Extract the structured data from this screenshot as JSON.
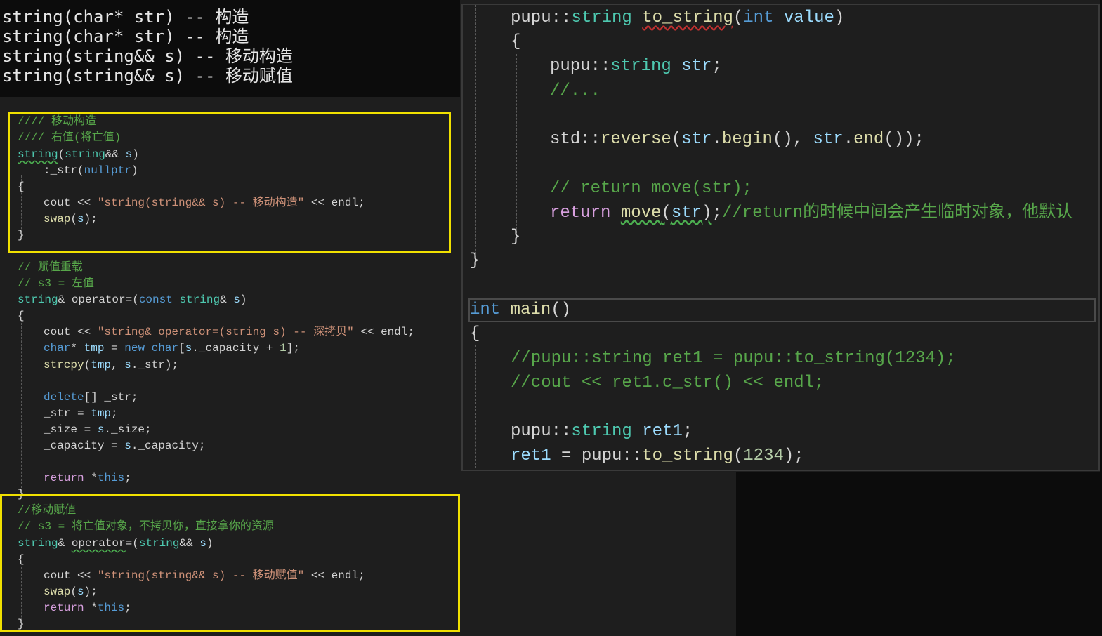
{
  "console": {
    "lines": [
      "string(char* str) -- 构造",
      "string(char* str) -- 构造",
      "string(string&& s) -- 移动构造",
      "string(string&& s) -- 移动赋值"
    ]
  },
  "left_code": {
    "c1": "//// 移动构造",
    "c2": "//// 右值(将亡值)",
    "c3": "// 赋值重载",
    "c4": "// s3 = 左值",
    "c5": "//移动赋值",
    "c6": "// s3 = 将亡值对象，不拷贝你，直接拿你的资源",
    "str_move_ctor": "\"string(string&& s) -- 移动构造\"",
    "str_copy_assign": "\"string& operator=(string s) -- 深拷贝\"",
    "str_move_assign": "\"string(string&& s) -- 移动赋值\""
  },
  "right_code": {
    "func_name": "to_string",
    "comment_etc": "//...",
    "comment_return": "// return move(str);",
    "comment_note": "//return的时候中间会产生临时对象，他默认",
    "main_name": "main",
    "comment_main1": "//pupu::string ret1 = pupu::to_string(1234);",
    "comment_main2": "//cout << ret1.c_str() << endl;",
    "number": "1234"
  },
  "colors": {
    "highlight": "#f0e000",
    "keyword": "#569cd6",
    "type": "#4ec9b0",
    "comment": "#57a64a",
    "string": "#ce9178"
  }
}
